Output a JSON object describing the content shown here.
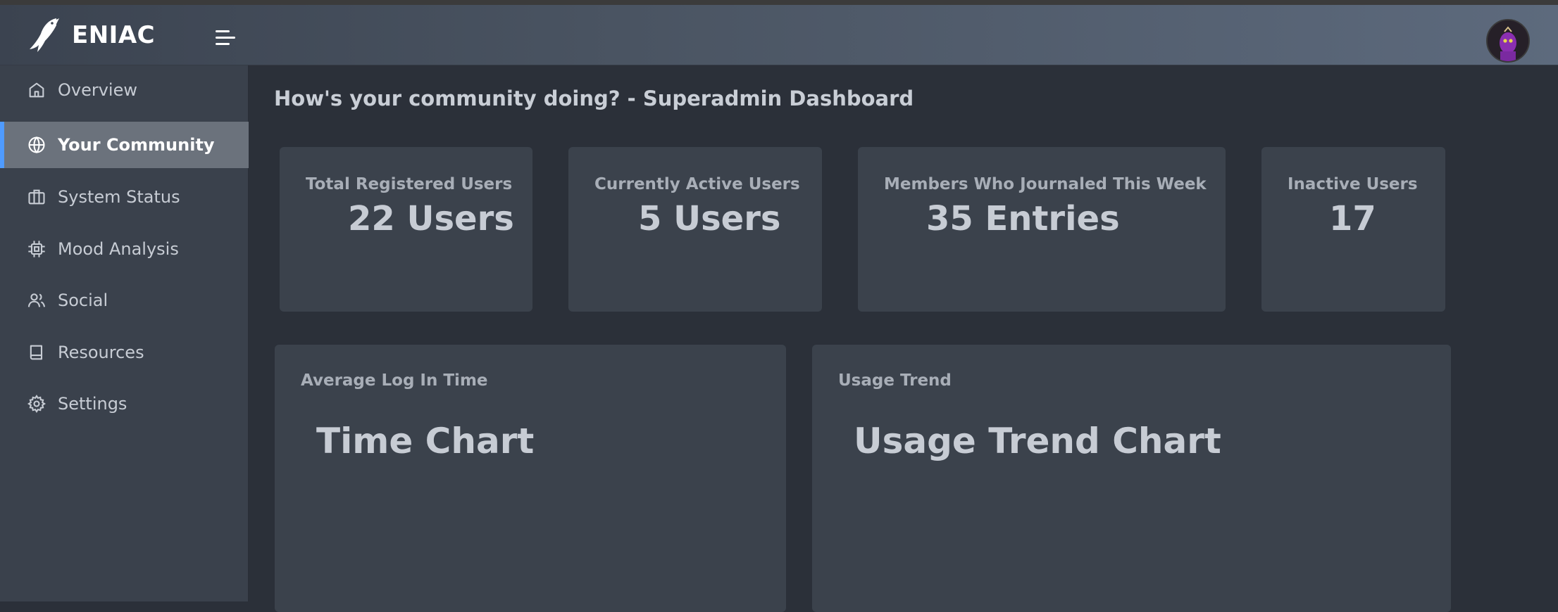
{
  "app": {
    "name": "ENIAC"
  },
  "header": {
    "menu_icon": "hamburger-menu-icon",
    "avatar_icon": "user-avatar"
  },
  "sidebar": {
    "items": [
      {
        "label": "Overview",
        "icon": "home-icon",
        "active": false
      },
      {
        "label": "Your Community",
        "icon": "globe-icon",
        "active": true
      },
      {
        "label": "System Status",
        "icon": "briefcase-icon",
        "active": false
      },
      {
        "label": "Mood Analysis",
        "icon": "cpu-icon",
        "active": false
      },
      {
        "label": "Social",
        "icon": "users-icon",
        "active": false
      },
      {
        "label": "Resources",
        "icon": "book-icon",
        "active": false
      },
      {
        "label": "Settings",
        "icon": "gear-icon",
        "active": false
      }
    ]
  },
  "main": {
    "title": "How's your community doing? - Superadmin Dashboard",
    "stats": [
      {
        "label": "Total Registered Users",
        "value": "22 Users"
      },
      {
        "label": "Currently Active Users",
        "value": "5 Users"
      },
      {
        "label": "Members Who Journaled This Week",
        "value": "35 Entries"
      },
      {
        "label": "Inactive Users",
        "value": "17"
      }
    ],
    "panels": [
      {
        "label": "Average Log In Time",
        "body": "Time Chart"
      },
      {
        "label": "Usage Trend",
        "body": "Usage Trend Chart"
      }
    ]
  },
  "colors": {
    "accent": "#4f9bff",
    "sidebar_bg": "#3a414c",
    "page_bg": "#2b3039",
    "card_bg": "#3b424c"
  }
}
